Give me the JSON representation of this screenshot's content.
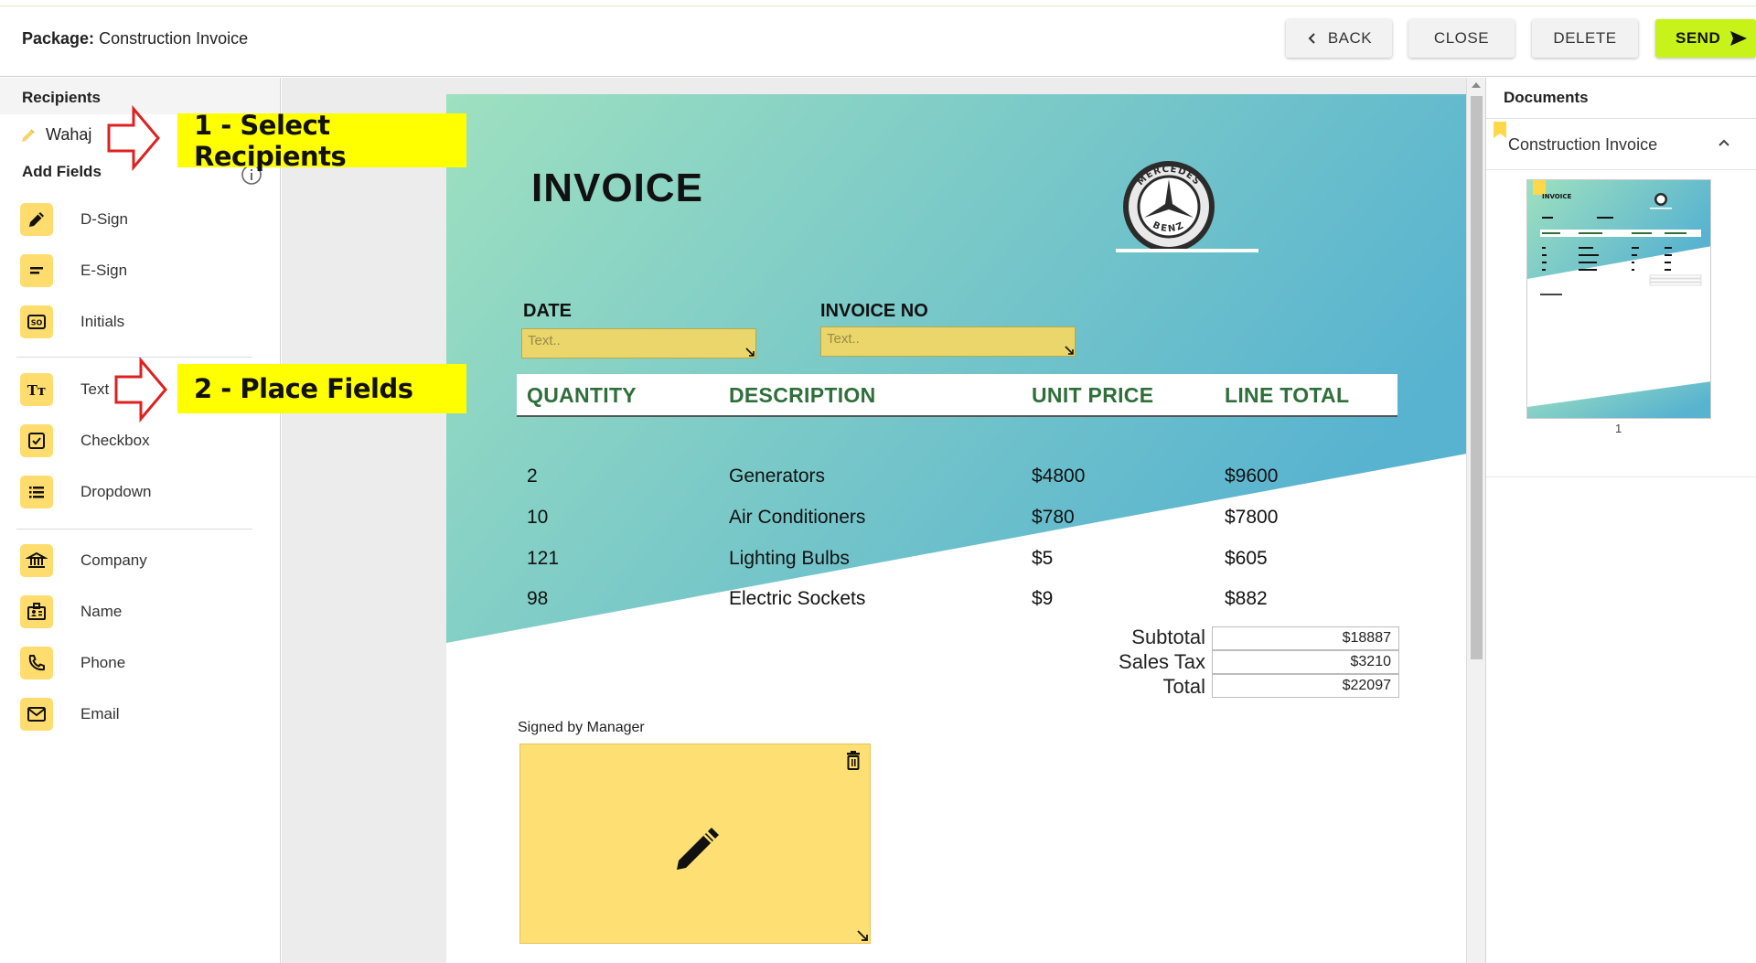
{
  "topbar": {
    "package_label": "Package:",
    "package_name": "Construction Invoice",
    "back_label": "BACK",
    "close_label": "CLOSE",
    "delete_label": "DELETE",
    "send_label": "SEND",
    "send_color": "#c7f21a"
  },
  "sidebar": {
    "recipients_title": "Recipients",
    "recipient_name": "Wahaj",
    "add_fields_title": "Add Fields",
    "fields": [
      {
        "label": "D-Sign",
        "icon": "pen-icon"
      },
      {
        "label": "E-Sign",
        "icon": "lines-icon"
      },
      {
        "label": "Initials",
        "icon": "initials-icon"
      },
      {
        "label": "Text",
        "icon": "text-icon"
      },
      {
        "label": "Checkbox",
        "icon": "checkbox-icon"
      },
      {
        "label": "Dropdown",
        "icon": "list-icon"
      },
      {
        "label": "Company",
        "icon": "bank-icon"
      },
      {
        "label": "Name",
        "icon": "id-badge-icon"
      },
      {
        "label": "Phone",
        "icon": "phone-icon"
      },
      {
        "label": "Email",
        "icon": "mail-icon"
      }
    ],
    "icon_bg": "#ffdc6e"
  },
  "callouts": {
    "step1": "1 - Select Recipients",
    "step2": "2 - Place Fields"
  },
  "invoice": {
    "title": "INVOICE",
    "logo_text_top": "MERCEDES",
    "logo_text_bottom": "BENZ",
    "date_label": "DATE",
    "invoice_no_label": "INVOICE NO",
    "text_placeholder": "Text..",
    "columns": [
      "QUANTITY",
      "DESCRIPTION",
      "UNIT PRICE",
      "LINE TOTAL"
    ],
    "rows": [
      {
        "qty": "2",
        "desc": "Generators",
        "price": "$4800",
        "total": "$9600"
      },
      {
        "qty": "10",
        "desc": "Air Conditioners",
        "price": "$780",
        "total": "$7800"
      },
      {
        "qty": "121",
        "desc": "Lighting Bulbs",
        "price": "$5",
        "total": "$605"
      },
      {
        "qty": "98",
        "desc": "Electric Sockets",
        "price": "$9",
        "total": "$882"
      }
    ],
    "subtotal_label": "Subtotal",
    "subtotal_value": "$18887",
    "tax_label": "Sales Tax",
    "tax_value": "$3210",
    "total_label": "Total",
    "total_value": "$22097",
    "signed_label": "Signed by Manager",
    "header_color": "#2e6f3a",
    "field_color": "#ead66a",
    "signature_color": "#fedf73"
  },
  "documents": {
    "title": "Documents",
    "doc_name": "Construction Invoice",
    "page_number": "1"
  }
}
